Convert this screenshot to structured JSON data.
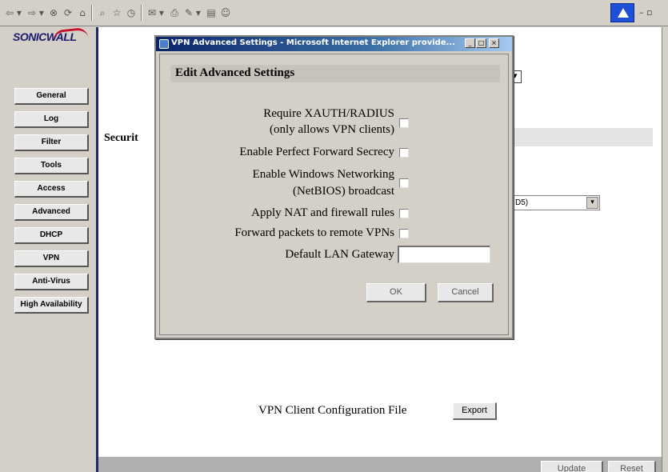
{
  "toolbar": {
    "back_glyph": "⇦ ▾",
    "forward_glyph": "⇨ ▾",
    "stop_glyph": "⊗",
    "refresh_glyph": "⟳",
    "home_glyph": "⌂",
    "search_glyph": "⌕",
    "favorites_glyph": "☆",
    "history_glyph": "◷",
    "mail_glyph": "✉ ▾",
    "print_glyph": "⎙",
    "edit_glyph": "✎ ▾",
    "discuss_glyph": "▤",
    "messenger_glyph": "☺",
    "window_controls": "– ▫"
  },
  "brand": {
    "name": "SONICWALL"
  },
  "nav": {
    "items": [
      {
        "label": "General"
      },
      {
        "label": "Log"
      },
      {
        "label": "Filter"
      },
      {
        "label": "Tools"
      },
      {
        "label": "Access"
      },
      {
        "label": "Advanced"
      },
      {
        "label": "DHCP"
      },
      {
        "label": "VPN"
      },
      {
        "label": "Anti-Virus"
      },
      {
        "label": "High Availability"
      }
    ]
  },
  "main": {
    "security_label": "Securit",
    "select_value": "D5)",
    "vpn_client_config_label": "VPN Client Configuration File",
    "export_button": "Export",
    "update_button": "Update",
    "reset_button": "Reset"
  },
  "dialog": {
    "title": "VPN Advanced Settings - Microsoft Internet Explorer provide...",
    "minimize_glyph": "_",
    "maximize_glyph": "□",
    "close_glyph": "×",
    "header": "Edit Advanced Settings",
    "options": {
      "xauth_line1": "Require XAUTH/RADIUS",
      "xauth_line2": "(only allows VPN clients)",
      "pfs": "Enable Perfect Forward Secrecy",
      "netbios_line1": "Enable Windows Networking",
      "netbios_line2": "(NetBIOS) broadcast",
      "nat": "Apply NAT and firewall rules",
      "forward": "Forward packets to remote VPNs",
      "gateway": "Default LAN Gateway"
    },
    "gateway_value": "",
    "ok_button": "OK",
    "cancel_button": "Cancel"
  }
}
